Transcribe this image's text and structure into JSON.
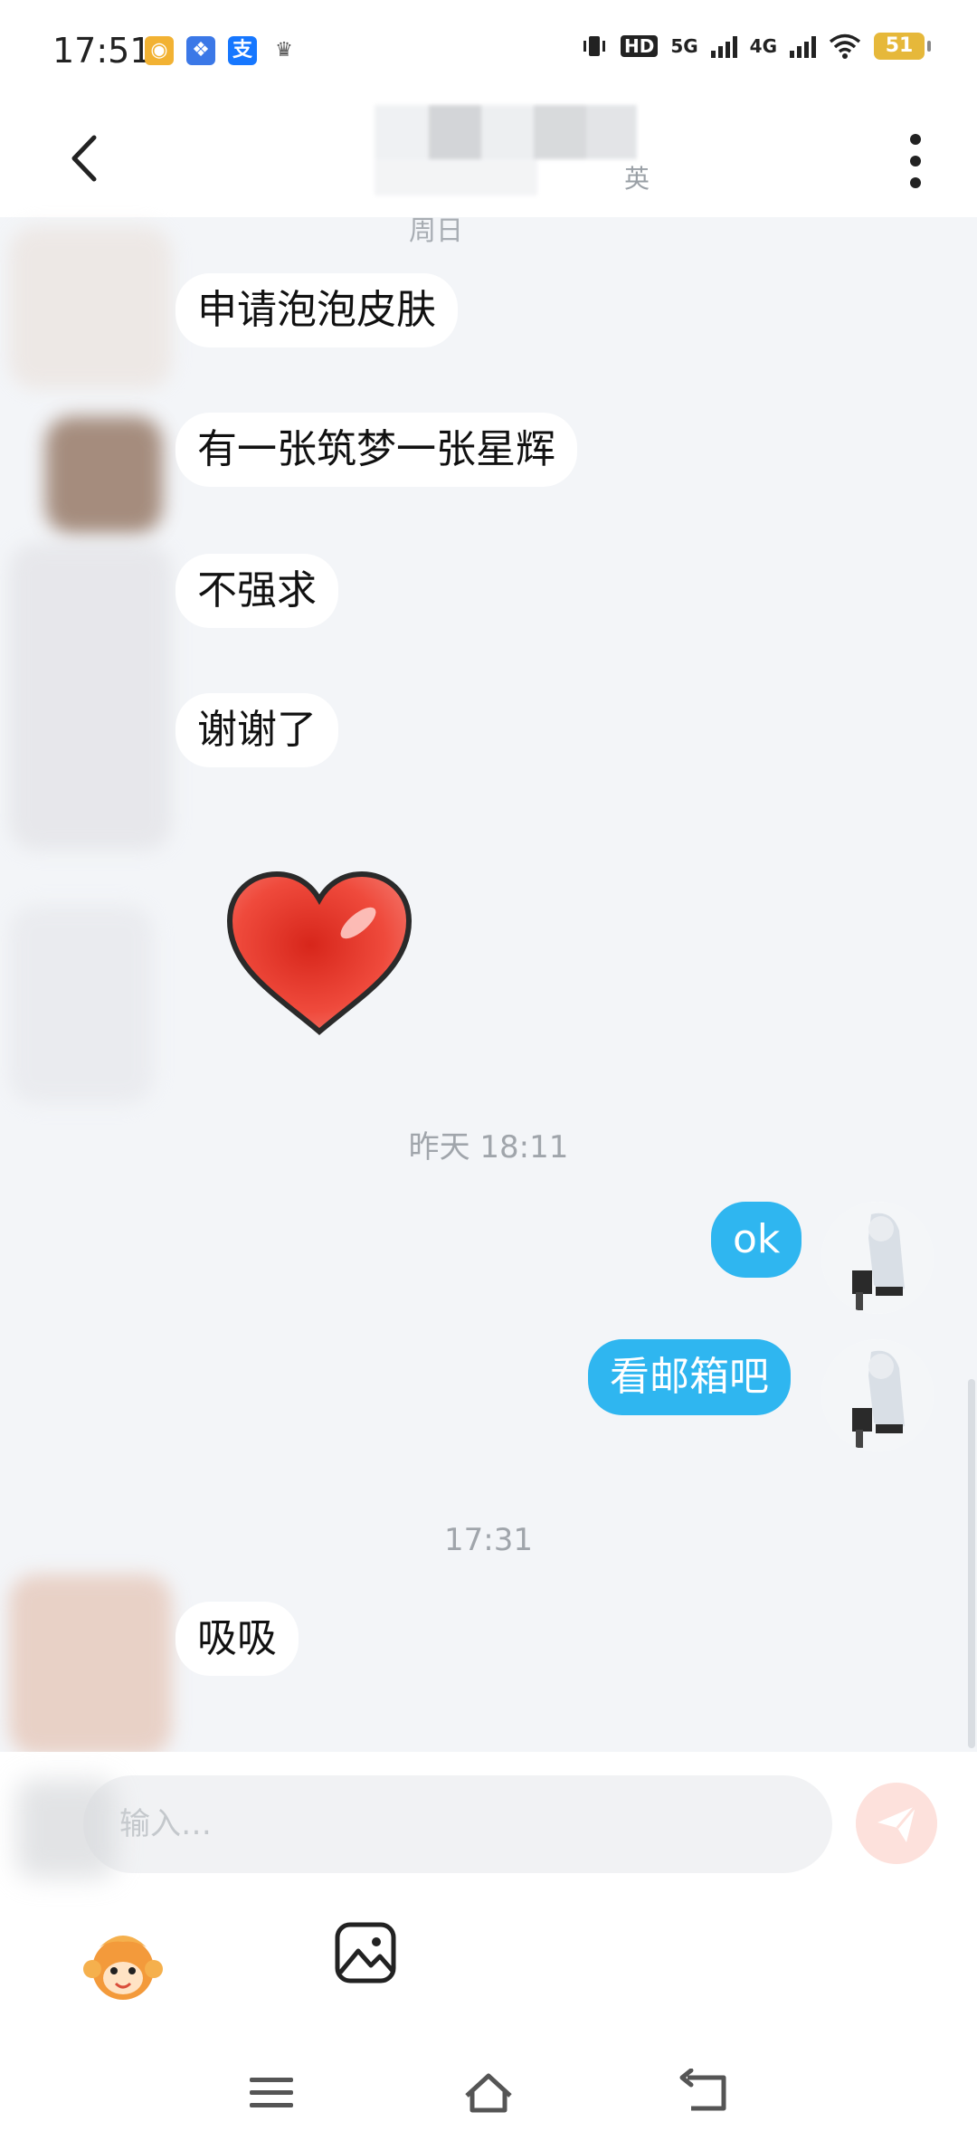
{
  "status_bar": {
    "time": "17:51",
    "app_icons": [
      {
        "icon": "weibo-icon",
        "glyph": "◉",
        "color": "#f2b233"
      },
      {
        "icon": "baidu-icon",
        "glyph": "❖",
        "color": "#3b78e7"
      },
      {
        "icon": "alipay-icon",
        "glyph": "支",
        "color": "#1677ff"
      },
      {
        "icon": "crown-icon",
        "glyph": "♛",
        "color": "#555555"
      }
    ],
    "hd_label": "HD",
    "net1": "5G",
    "net2": "4G",
    "battery": "51"
  },
  "header": {
    "title_subtext": "英"
  },
  "chat": {
    "day_stub": "周日",
    "incoming": [
      {
        "text": "申请泡泡皮肤"
      },
      {
        "text": "有一张筑梦一张星辉"
      },
      {
        "text": "不强求"
      },
      {
        "text": "谢谢了"
      }
    ],
    "sticker": "heart-sticker",
    "timestamp_1": "昨天 18:11",
    "outgoing": [
      {
        "text": "ok"
      },
      {
        "text": "看邮箱吧"
      }
    ],
    "timestamp_2": "17:31",
    "incoming_2": [
      {
        "text": "吸吸"
      }
    ]
  },
  "input": {
    "placeholder": "输入…"
  },
  "colors": {
    "outgoing_bubble": "#2fb6f0",
    "incoming_bubble": "#ffffff",
    "background": "#f3f5f8",
    "send_button": "#fde1dc"
  }
}
